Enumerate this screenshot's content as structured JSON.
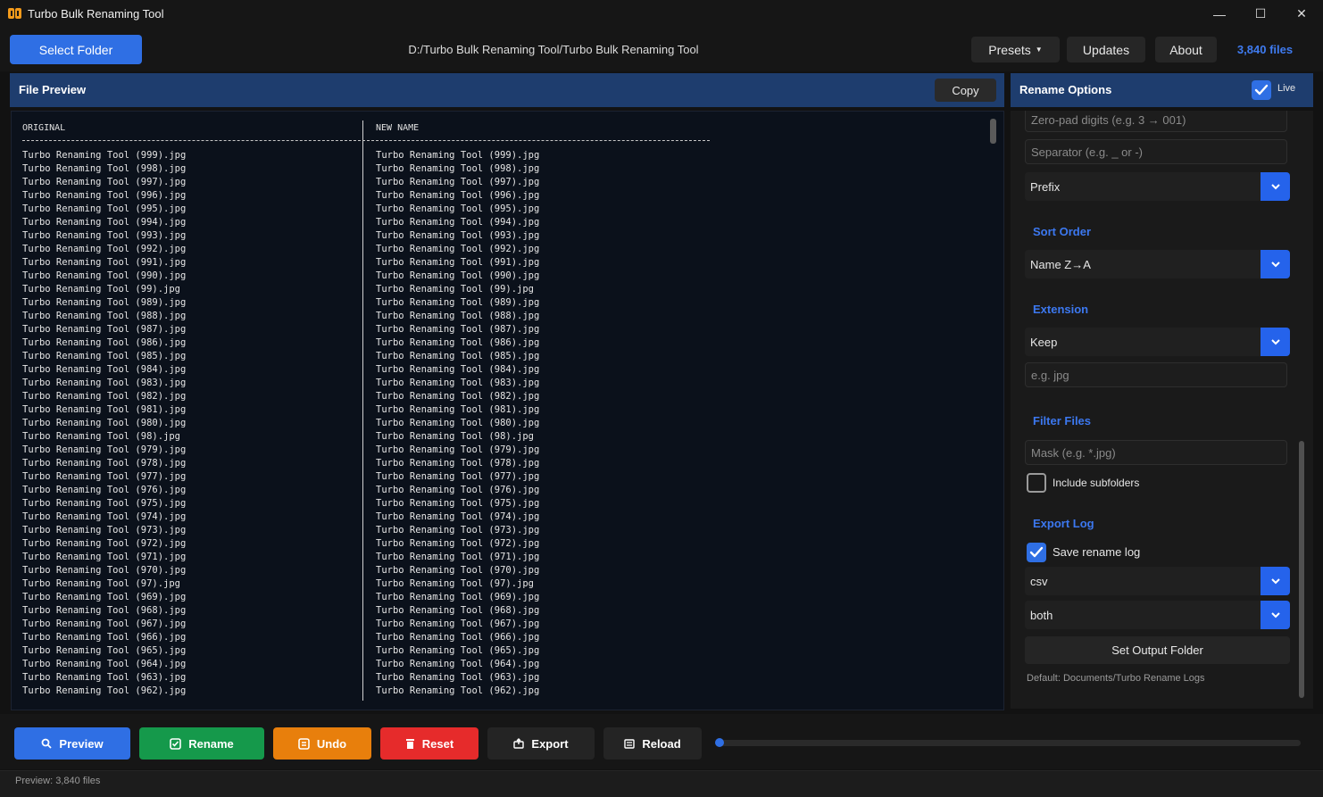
{
  "window": {
    "title": "Turbo Bulk Renaming Tool",
    "minimize_glyph": "—",
    "maximize_glyph": "☐",
    "close_glyph": "✕"
  },
  "toolbar": {
    "select_folder": "Select Folder",
    "path": "D:/Turbo Bulk Renaming Tool/Turbo Bulk Renaming Tool",
    "presets": "Presets",
    "updates": "Updates",
    "about": "About",
    "file_count": "3,840 files"
  },
  "preview": {
    "title": "File Preview",
    "copy": "Copy",
    "col_original": "ORIGINAL",
    "col_new": "NEW NAME",
    "original_rows": "Turbo Renaming Tool (999).jpg\nTurbo Renaming Tool (998).jpg\nTurbo Renaming Tool (997).jpg\nTurbo Renaming Tool (996).jpg\nTurbo Renaming Tool (995).jpg\nTurbo Renaming Tool (994).jpg\nTurbo Renaming Tool (993).jpg\nTurbo Renaming Tool (992).jpg\nTurbo Renaming Tool (991).jpg\nTurbo Renaming Tool (990).jpg\nTurbo Renaming Tool (99).jpg\nTurbo Renaming Tool (989).jpg\nTurbo Renaming Tool (988).jpg\nTurbo Renaming Tool (987).jpg\nTurbo Renaming Tool (986).jpg\nTurbo Renaming Tool (985).jpg\nTurbo Renaming Tool (984).jpg\nTurbo Renaming Tool (983).jpg\nTurbo Renaming Tool (982).jpg\nTurbo Renaming Tool (981).jpg\nTurbo Renaming Tool (980).jpg\nTurbo Renaming Tool (98).jpg\nTurbo Renaming Tool (979).jpg\nTurbo Renaming Tool (978).jpg\nTurbo Renaming Tool (977).jpg\nTurbo Renaming Tool (976).jpg\nTurbo Renaming Tool (975).jpg\nTurbo Renaming Tool (974).jpg\nTurbo Renaming Tool (973).jpg\nTurbo Renaming Tool (972).jpg\nTurbo Renaming Tool (971).jpg\nTurbo Renaming Tool (970).jpg\nTurbo Renaming Tool (97).jpg\nTurbo Renaming Tool (969).jpg\nTurbo Renaming Tool (968).jpg\nTurbo Renaming Tool (967).jpg\nTurbo Renaming Tool (966).jpg\nTurbo Renaming Tool (965).jpg\nTurbo Renaming Tool (964).jpg\nTurbo Renaming Tool (963).jpg\nTurbo Renaming Tool (962).jpg",
    "new_rows": "Turbo Renaming Tool (999).jpg\nTurbo Renaming Tool (998).jpg\nTurbo Renaming Tool (997).jpg\nTurbo Renaming Tool (996).jpg\nTurbo Renaming Tool (995).jpg\nTurbo Renaming Tool (994).jpg\nTurbo Renaming Tool (993).jpg\nTurbo Renaming Tool (992).jpg\nTurbo Renaming Tool (991).jpg\nTurbo Renaming Tool (990).jpg\nTurbo Renaming Tool (99).jpg\nTurbo Renaming Tool (989).jpg\nTurbo Renaming Tool (988).jpg\nTurbo Renaming Tool (987).jpg\nTurbo Renaming Tool (986).jpg\nTurbo Renaming Tool (985).jpg\nTurbo Renaming Tool (984).jpg\nTurbo Renaming Tool (983).jpg\nTurbo Renaming Tool (982).jpg\nTurbo Renaming Tool (981).jpg\nTurbo Renaming Tool (980).jpg\nTurbo Renaming Tool (98).jpg\nTurbo Renaming Tool (979).jpg\nTurbo Renaming Tool (978).jpg\nTurbo Renaming Tool (977).jpg\nTurbo Renaming Tool (976).jpg\nTurbo Renaming Tool (975).jpg\nTurbo Renaming Tool (974).jpg\nTurbo Renaming Tool (973).jpg\nTurbo Renaming Tool (972).jpg\nTurbo Renaming Tool (971).jpg\nTurbo Renaming Tool (970).jpg\nTurbo Renaming Tool (97).jpg\nTurbo Renaming Tool (969).jpg\nTurbo Renaming Tool (968).jpg\nTurbo Renaming Tool (967).jpg\nTurbo Renaming Tool (966).jpg\nTurbo Renaming Tool (965).jpg\nTurbo Renaming Tool (964).jpg\nTurbo Renaming Tool (963).jpg\nTurbo Renaming Tool (962).jpg"
  },
  "options": {
    "title": "Rename Options",
    "live": "Live",
    "zero_pad_placeholder": "Zero-pad digits (e.g. 3 → 001)",
    "separator_placeholder": "Separator (e.g. _ or -)",
    "position_value": "Prefix",
    "sort_order_label": "Sort Order",
    "sort_order_value": "Name Z→A",
    "extension_label": "Extension",
    "extension_value": "Keep",
    "extension_placeholder": "e.g. jpg",
    "filter_label": "Filter Files",
    "mask_placeholder": "Mask (e.g. *.jpg)",
    "include_subfolders": "Include subfolders",
    "export_log_label": "Export Log",
    "save_log": "Save rename log",
    "log_format": "csv",
    "log_mode": "both",
    "set_output_folder": "Set Output Folder",
    "default_path": "Default: Documents/Turbo Rename Logs"
  },
  "actions": {
    "preview": "Preview",
    "rename": "Rename",
    "undo": "Undo",
    "reset": "Reset",
    "export": "Export",
    "reload": "Reload",
    "progress": 0
  },
  "status": {
    "text": "Preview: 3,840 files"
  },
  "colors": {
    "accent": "#2f6fe4",
    "rename": "#15994b",
    "undo": "#e87f0c",
    "reset": "#e62b2b"
  }
}
